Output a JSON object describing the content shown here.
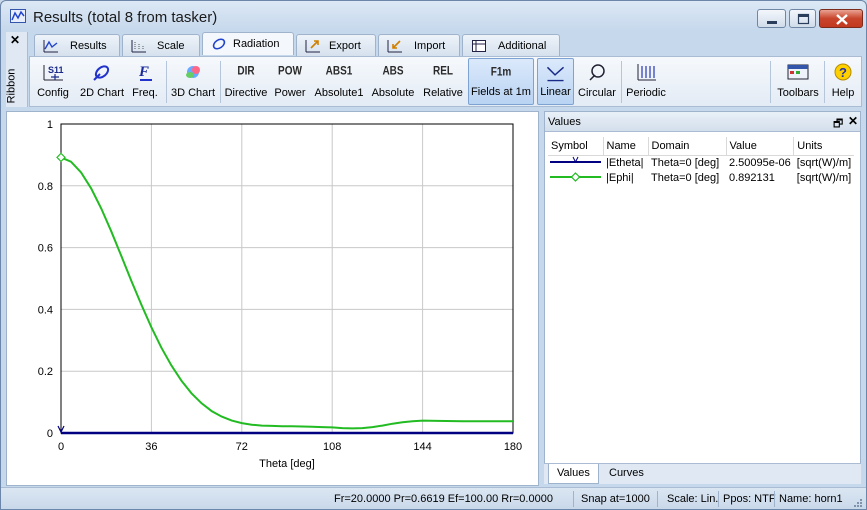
{
  "window": {
    "title": "Results (total 8 from tasker)"
  },
  "ribbon": {
    "close_glyph": "✕",
    "label": "Ribbon"
  },
  "tabs": [
    {
      "label": "Results",
      "icon": "results-tab-icon"
    },
    {
      "label": "Scale",
      "icon": "scale-tab-icon"
    },
    {
      "label": "Radiation",
      "icon": "radiation-tab-icon",
      "active": true
    },
    {
      "label": "Export",
      "icon": "export-tab-icon"
    },
    {
      "label": "Import",
      "icon": "import-tab-icon"
    },
    {
      "label": "Additional",
      "icon": "additional-tab-icon"
    }
  ],
  "toolbar": {
    "config": {
      "label": "Config",
      "glyph": "S11"
    },
    "chart2d": {
      "label": "2D Chart"
    },
    "freq": {
      "label": "Freq.",
      "glyph": "F"
    },
    "chart3d": {
      "label": "3D Chart"
    },
    "directive": {
      "label": "Directive",
      "glyph": "DIR"
    },
    "power": {
      "label": "Power",
      "glyph": "POW"
    },
    "absolute1": {
      "label": "Absolute1",
      "glyph": "ABS1"
    },
    "absolute": {
      "label": "Absolute",
      "glyph": "ABS"
    },
    "relative": {
      "label": "Relative",
      "glyph": "REL"
    },
    "fields1m": {
      "label": "Fields at 1m",
      "glyph": "F1m",
      "active": true
    },
    "linear": {
      "label": "Linear",
      "active": true
    },
    "circular": {
      "label": "Circular"
    },
    "periodic": {
      "label": "Periodic"
    },
    "toolbars": {
      "label": "Toolbars"
    },
    "help": {
      "label": "Help"
    }
  },
  "chart_data": {
    "type": "line",
    "xlabel": "Theta [deg]",
    "ylabel": "",
    "xlim": [
      0,
      180
    ],
    "ylim": [
      0,
      1
    ],
    "x_ticks": [
      "0",
      "36",
      "72",
      "108",
      "144",
      "180"
    ],
    "y_ticks": [
      "0",
      "0.2",
      "0.4",
      "0.6",
      "0.8",
      "1"
    ],
    "grid": true,
    "series": [
      {
        "name": "|Etheta|",
        "color": "#000080",
        "x": [
          0,
          20,
          40,
          60,
          80,
          100,
          120,
          140,
          160,
          180
        ],
        "y": [
          0,
          0,
          0,
          0,
          0,
          0,
          0,
          0,
          0,
          0
        ]
      },
      {
        "name": "|Ephi|",
        "color": "#22bb22",
        "x": [
          0,
          4,
          8,
          12,
          16,
          20,
          24,
          28,
          32,
          36,
          40,
          44,
          48,
          52,
          56,
          60,
          64,
          68,
          72,
          76,
          80,
          84,
          88,
          92,
          96,
          100,
          104,
          108,
          112,
          116,
          120,
          124,
          128,
          132,
          136,
          140,
          144,
          150,
          160,
          170,
          180
        ],
        "y": [
          0.892,
          0.878,
          0.843,
          0.792,
          0.727,
          0.653,
          0.573,
          0.493,
          0.415,
          0.342,
          0.276,
          0.218,
          0.169,
          0.128,
          0.096,
          0.071,
          0.053,
          0.04,
          0.032,
          0.027,
          0.024,
          0.023,
          0.022,
          0.022,
          0.021,
          0.02,
          0.019,
          0.018,
          0.016,
          0.015,
          0.016,
          0.019,
          0.024,
          0.03,
          0.035,
          0.038,
          0.04,
          0.039,
          0.038,
          0.038,
          0.038
        ]
      }
    ]
  },
  "values_panel": {
    "title": "Values",
    "float_glyph": "🗗",
    "close_glyph": "✕",
    "columns": [
      "Symbol",
      "Name",
      "Domain",
      "Value",
      "Units"
    ],
    "rows": [
      {
        "name": "|Etheta|",
        "domain": "Theta=0 [deg]",
        "value": "2.50095e-06",
        "units": "[sqrt(W)/m]",
        "color": "#000080"
      },
      {
        "name": "|Ephi|",
        "domain": "Theta=0 [deg]",
        "value": "0.892131",
        "units": "[sqrt(W)/m]",
        "color": "#22bb22"
      }
    ],
    "tabs": [
      "Values",
      "Curves"
    ]
  },
  "status": {
    "params": "Fr=20.0000 Pr=0.6619 Ef=100.00 Rr=0.0000",
    "snap": "Snap at=1000",
    "scale": "Scale: Lin.",
    "ppos": "Ppos: NTF",
    "name": "Name: horn1"
  }
}
